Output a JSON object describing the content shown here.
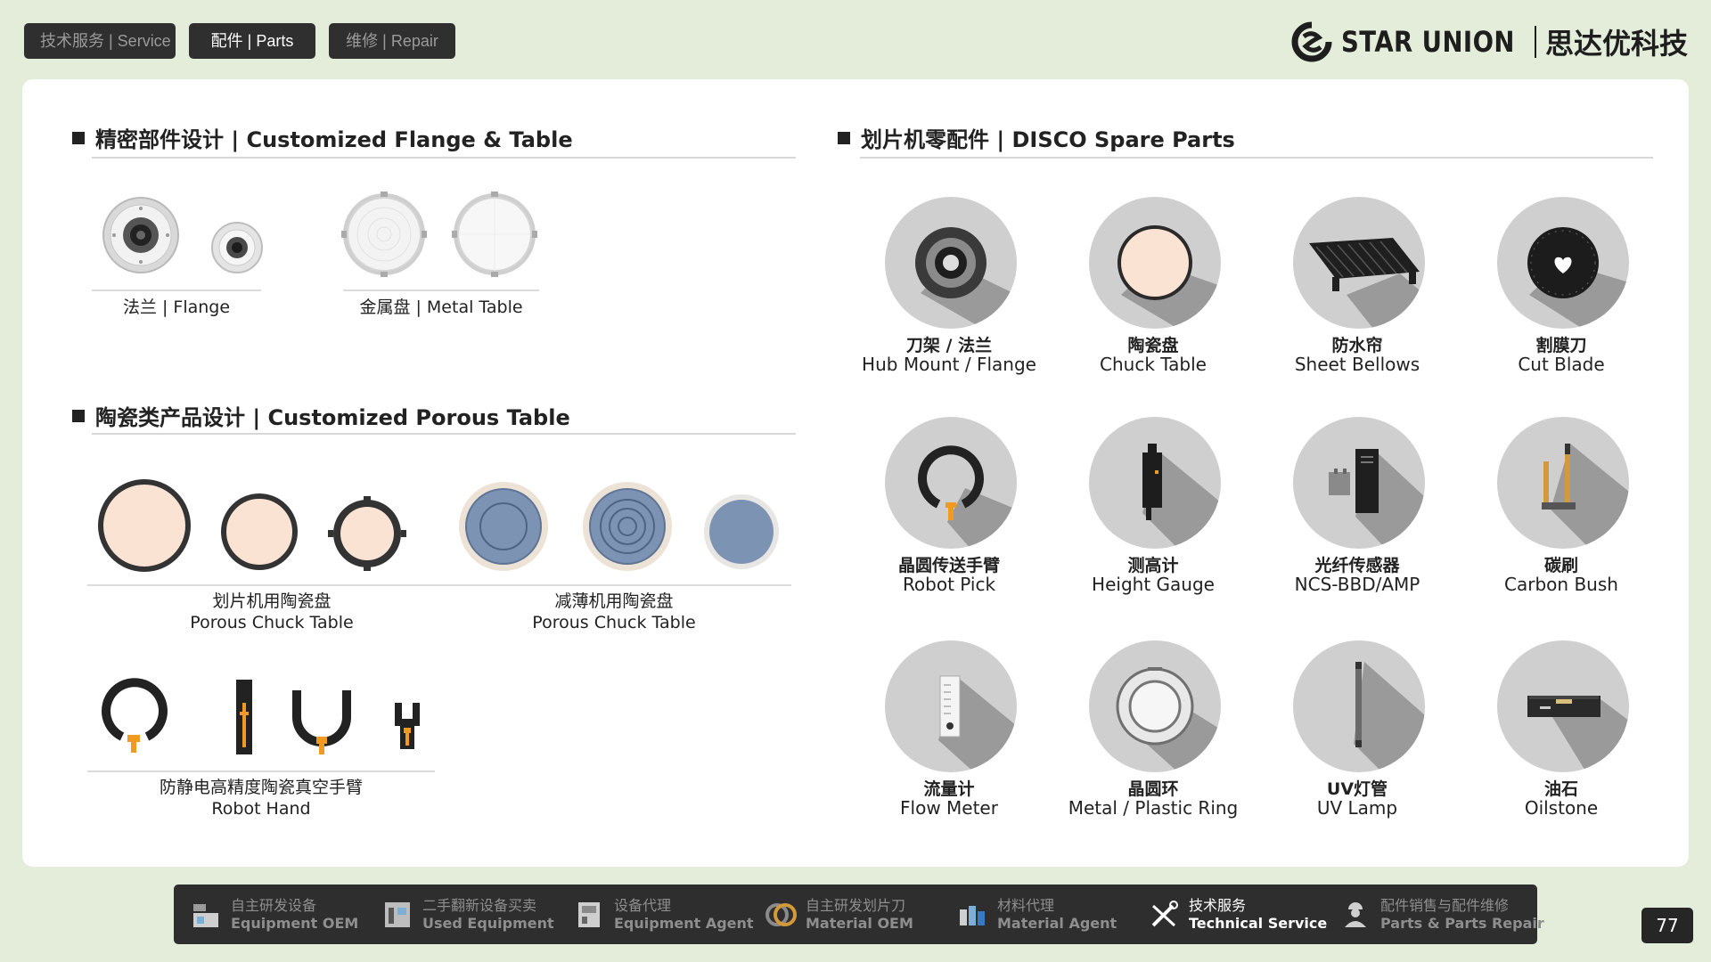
{
  "top_tabs": [
    {
      "label": "技术服务 | Service",
      "active": false
    },
    {
      "label": "配件 | Parts",
      "active": true
    },
    {
      "label": "维修 | Repair",
      "active": false
    }
  ],
  "brand": {
    "name": "STAR UNION",
    "cn": "思达优科技"
  },
  "left": {
    "flange_section": {
      "title": "精密部件设计 | Customized Flange & Table",
      "flange_caption": "法兰 | Flange",
      "table_caption": "金属盘 | Metal Table"
    },
    "porous_section": {
      "title": "陶瓷类产品设计 | Customized Porous Table",
      "dicing_caption_cn": "划片机用陶瓷盘",
      "dicing_caption_en": "Porous Chuck Table",
      "thinning_caption_cn": "减薄机用陶瓷盘",
      "thinning_caption_en": "Porous Chuck Table",
      "hand_caption_cn": "防静电高精度陶瓷真空手臂",
      "hand_caption_en": "Robot Hand"
    }
  },
  "disco": {
    "title": "划片机零配件 | DISCO Spare Parts",
    "items": [
      {
        "cn": "刀架 / 法兰",
        "en": "Hub Mount / Flange",
        "icon": "flange-icon"
      },
      {
        "cn": "陶瓷盘",
        "en": "Chuck Table",
        "icon": "chuck-table-icon"
      },
      {
        "cn": "防水帘",
        "en": "Sheet Bellows",
        "icon": "bellows-icon"
      },
      {
        "cn": "割膜刀",
        "en": "Cut Blade",
        "icon": "blade-icon"
      },
      {
        "cn": "晶圆传送手臂",
        "en": "Robot Pick",
        "icon": "robot-pick-icon"
      },
      {
        "cn": "测高计",
        "en": "Height Gauge",
        "icon": "height-gauge-icon"
      },
      {
        "cn": "光纤传感器",
        "en": "NCS-BBD/AMP",
        "icon": "fiber-sensor-icon"
      },
      {
        "cn": "碳刷",
        "en": "Carbon Bush",
        "icon": "carbon-brush-icon"
      },
      {
        "cn": "流量计",
        "en": "Flow Meter",
        "icon": "flow-meter-icon"
      },
      {
        "cn": "晶圆环",
        "en": "Metal / Plastic Ring",
        "icon": "wafer-ring-icon"
      },
      {
        "cn": "UV灯管",
        "en": "UV Lamp",
        "icon": "uv-lamp-icon"
      },
      {
        "cn": "油石",
        "en": "Oilstone",
        "icon": "oilstone-icon"
      }
    ]
  },
  "bottom_nav": [
    {
      "cn": "自主研发设备",
      "en": "Equipment OEM",
      "icon": "equipment-icon",
      "active": false
    },
    {
      "cn": "二手翻新设备买卖",
      "en": "Used Equipment",
      "icon": "used-equipment-icon",
      "active": false
    },
    {
      "cn": "设备代理",
      "en": "Equipment Agent",
      "icon": "agent-icon",
      "active": false
    },
    {
      "cn": "自主研发划片刀",
      "en": "Material OEM",
      "icon": "blade-ring-icon",
      "active": false
    },
    {
      "cn": "材料代理",
      "en": "Material Agent",
      "icon": "material-icon",
      "active": false
    },
    {
      "cn": "技术服务",
      "en": "Technical Service",
      "icon": "tools-icon",
      "active": true
    },
    {
      "cn": "配件销售与配件维修",
      "en": "Parts & Parts Repair",
      "icon": "worker-icon",
      "active": false
    }
  ],
  "page_number": "77",
  "colors": {
    "background": "#e3edd9",
    "card": "#ffffff",
    "dark": "#2e2e2e",
    "ceramic": "#fbe3d3",
    "porous_blue": "#7c93b4",
    "accent_orange": "#f29a1f"
  }
}
